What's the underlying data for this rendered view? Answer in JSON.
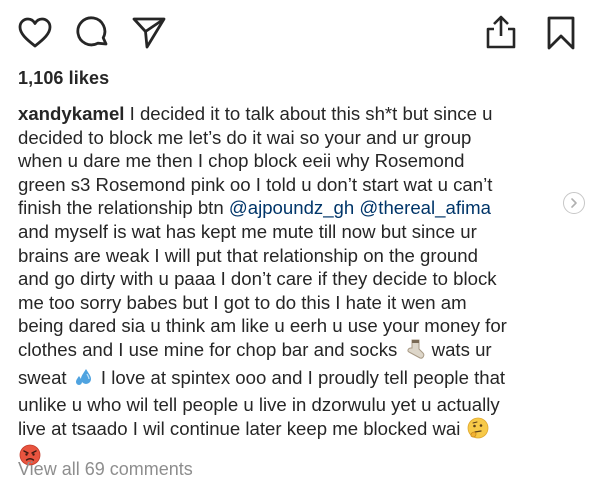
{
  "actions": {
    "like_icon": "heart-outline-icon",
    "comment_icon": "comment-bubble-icon",
    "share_icon": "paper-plane-icon",
    "upload_icon": "share-upload-icon",
    "save_icon": "bookmark-icon"
  },
  "post": {
    "likes": "1,106 likes",
    "username": "xandykamel",
    "caption_lines": [
      " I decided it to talk about this sh*t but since u",
      "decided to block me let’s do it wai so your and ur group",
      "when u dare me then I chop block eeii why Rosemond",
      "green s3 Rosemond pink oo I told u don’t start wat u can’t",
      "finish the relationship btn ",
      "and myself is wat has kept me mute till now but since ur",
      "brains are weak I will put that relationship on the ground",
      "and go dirty with u paaa I don’t care if they decide to block",
      "me too sorry babes but I got to do this I hate it wen am",
      "being dared sia u think am like u eerh u use your money for",
      "clothes and I use mine for chop bar and socks ",
      " wats ur",
      "sweat ",
      " I love at spintex ooo and I proudly tell people that",
      "unlike u who wil tell people u live in dzorwulu yet u actually",
      "live at tsaado I wil continue later keep me blocked wai "
    ],
    "mention_1": "@ajpoundz_gh",
    "mention_2": "@thereal_afima",
    "mention_separator": " ",
    "emojis": {
      "sock": "socks-emoji",
      "sweat": "sweat-droplets-emoji",
      "thinking": "thinking-face-emoji",
      "angry": "angry-face-emoji"
    },
    "view_comments": "View all 69 comments"
  },
  "colors": {
    "text": "#262626",
    "mention": "#003569",
    "muted": "#8e8e8e"
  }
}
